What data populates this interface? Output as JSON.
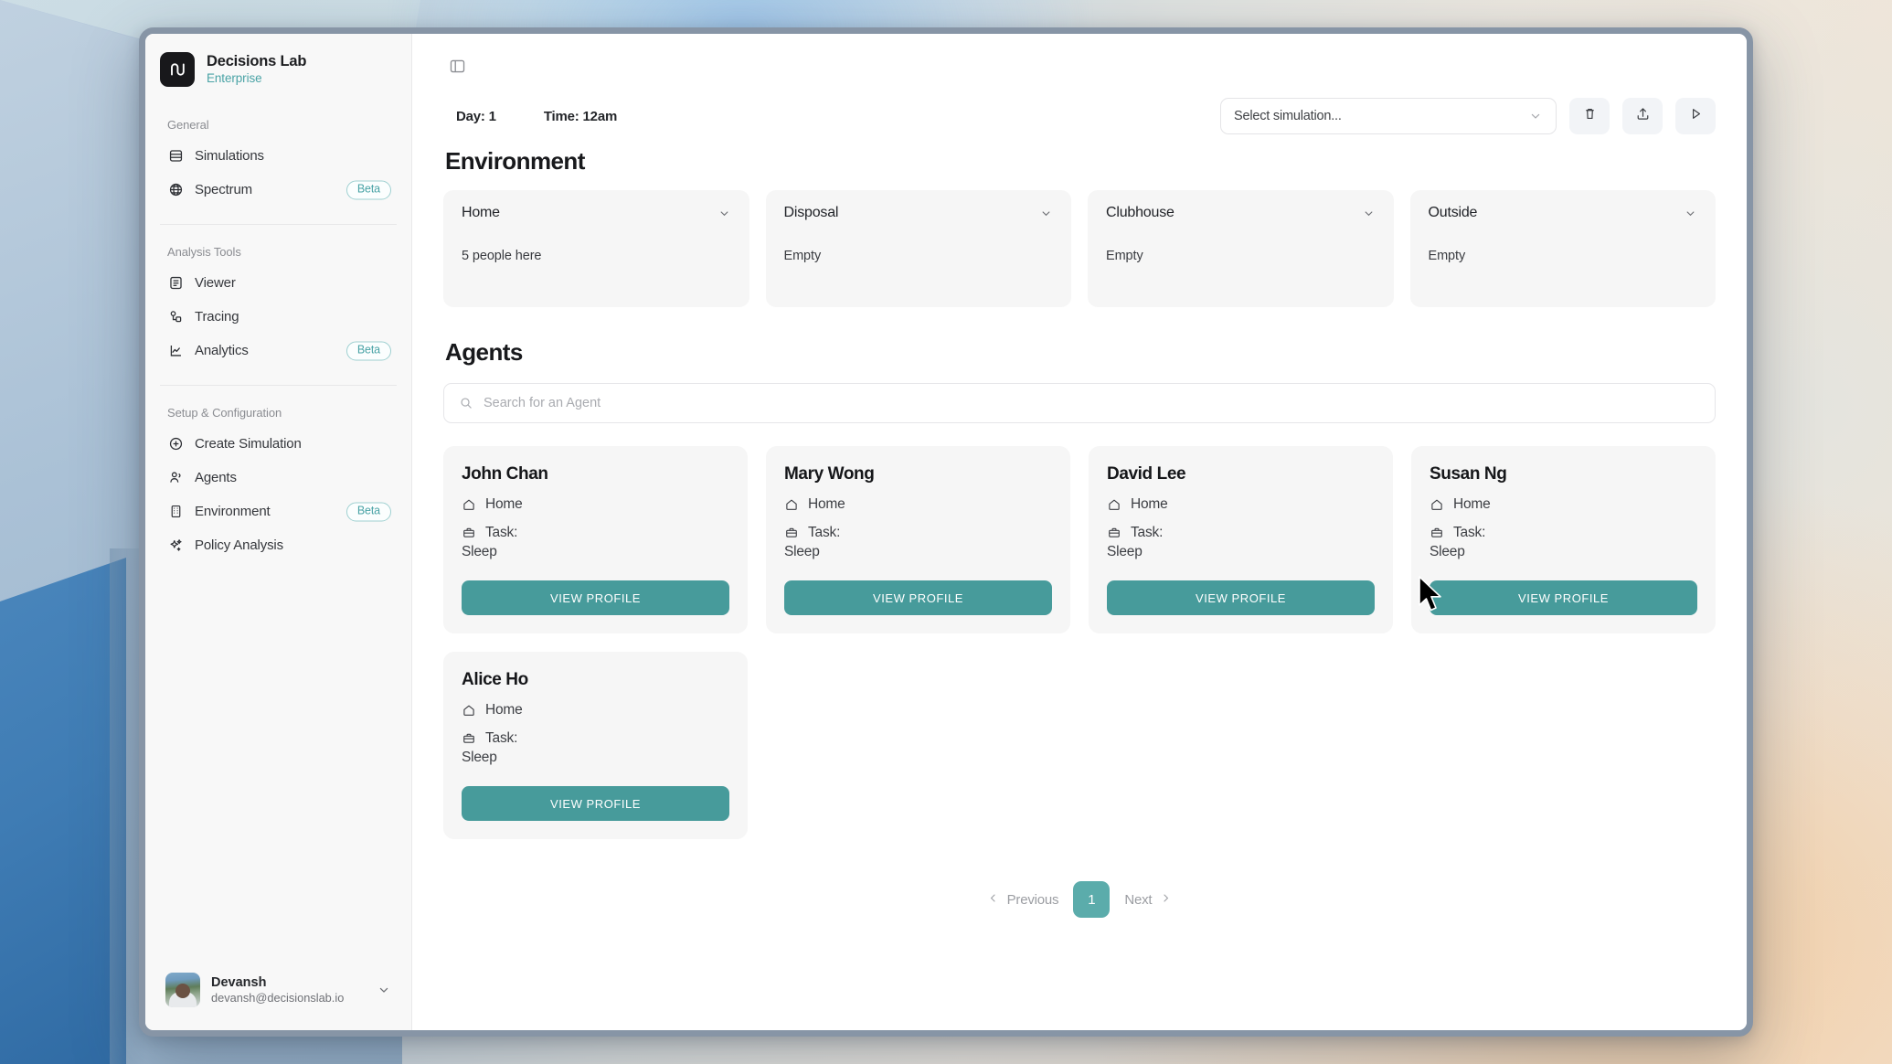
{
  "brand": {
    "name": "Decisions Lab",
    "plan": "Enterprise",
    "logo_icon": "decisions-lab-logo"
  },
  "sidebar": {
    "groups": [
      {
        "label": "General",
        "items": [
          {
            "label": "Simulations",
            "icon": "database-icon",
            "badge": ""
          },
          {
            "label": "Spectrum",
            "icon": "globe-icon",
            "badge": "Beta"
          }
        ]
      },
      {
        "label": "Analysis Tools",
        "items": [
          {
            "label": "Viewer",
            "icon": "document-text-icon",
            "badge": ""
          },
          {
            "label": "Tracing",
            "icon": "nodes-icon",
            "badge": ""
          },
          {
            "label": "Analytics",
            "icon": "line-chart-icon",
            "badge": "Beta"
          }
        ]
      },
      {
        "label": "Setup & Configuration",
        "items": [
          {
            "label": "Create Simulation",
            "icon": "plus-circle-icon",
            "badge": ""
          },
          {
            "label": "Agents",
            "icon": "users-icon",
            "badge": ""
          },
          {
            "label": "Environment",
            "icon": "building-icon",
            "badge": "Beta"
          },
          {
            "label": "Policy Analysis",
            "icon": "sparkles-icon",
            "badge": ""
          }
        ]
      }
    ],
    "user": {
      "name": "Devansh",
      "email": "devansh@decisionslab.io",
      "avatar_icon": "user-avatar",
      "chevron_icon": "chevron-down-icon"
    }
  },
  "topbar": {
    "panel_toggle_icon": "sidebar-toggle-icon",
    "day_label": "Day: 1",
    "time_label": "Time: 12am",
    "simulation_select": {
      "value": "Select simulation...",
      "chevron_icon": "chevron-down-icon"
    },
    "actions": [
      {
        "name": "delete-simulation-button",
        "icon": "trash-icon"
      },
      {
        "name": "upload-simulation-button",
        "icon": "upload-icon"
      },
      {
        "name": "run-simulation-button",
        "icon": "play-icon"
      }
    ]
  },
  "environment": {
    "title": "Environment",
    "locations": [
      {
        "name": "Home",
        "status": "5 people here",
        "chevron_icon": "chevron-down-icon"
      },
      {
        "name": "Disposal",
        "status": "Empty",
        "chevron_icon": "chevron-down-icon"
      },
      {
        "name": "Clubhouse",
        "status": "Empty",
        "chevron_icon": "chevron-down-icon"
      },
      {
        "name": "Outside",
        "status": "Empty",
        "chevron_icon": "chevron-down-icon"
      }
    ]
  },
  "agents": {
    "title": "Agents",
    "search": {
      "placeholder": "Search for an Agent",
      "value": "",
      "icon": "search-icon"
    },
    "task_label": "Task:",
    "view_profile_label": "VIEW PROFILE",
    "location_icon": "home-icon",
    "task_icon": "briefcase-icon",
    "list": [
      {
        "name": "John Chan",
        "location": "Home",
        "task": "Sleep"
      },
      {
        "name": "Mary Wong",
        "location": "Home",
        "task": "Sleep"
      },
      {
        "name": "David Lee",
        "location": "Home",
        "task": "Sleep"
      },
      {
        "name": "Susan Ng",
        "location": "Home",
        "task": "Sleep"
      },
      {
        "name": "Alice Ho",
        "location": "Home",
        "task": "Sleep"
      }
    ]
  },
  "pagination": {
    "previous_label": "Previous",
    "next_label": "Next",
    "current_page": "1",
    "prev_icon": "chevron-left-icon",
    "next_icon": "chevron-right-icon"
  },
  "colors": {
    "accent_teal": "#479b9b",
    "page_active": "#5bacab",
    "beta_badge": "#4aa3a6",
    "card_bg": "#f6f6f6"
  }
}
